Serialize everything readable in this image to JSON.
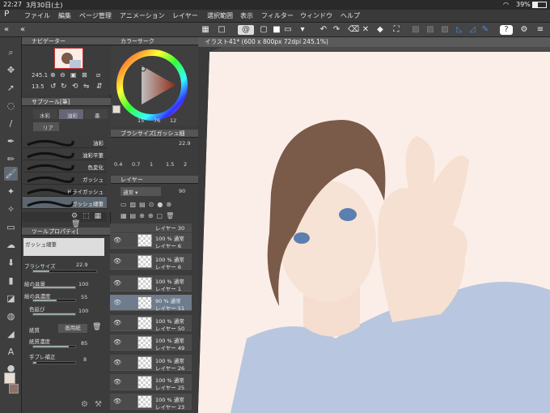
{
  "status": {
    "time": "22:27",
    "date": "3月30日(土)",
    "battery": "39%"
  },
  "menu": [
    "ファイル",
    "編集",
    "ページ管理",
    "アニメーション",
    "レイヤー",
    "選択範囲",
    "表示",
    "フィルター",
    "ウィンドウ",
    "ヘルプ"
  ],
  "document": {
    "tab": "イラスト41* (600 x 800px 72dpi 245.1%)"
  },
  "navigator": {
    "title": "ナビゲーター",
    "zoom": "245.1",
    "angle": "13.5"
  },
  "color": {
    "title": "カラーサーク",
    "h": "15",
    "s": "76",
    "v": "12"
  },
  "subtool": {
    "title": "サブツール[筆]",
    "tabs": [
      "水彩",
      "油彩",
      "墨"
    ],
    "group": "リア",
    "brushes": [
      "油彩",
      "油彩平筆",
      "色変化",
      "ガッシュ",
      "ドライガッシュ",
      "ガッシュ細筆"
    ]
  },
  "brushsize": {
    "title": "ブラシサイズ[ガッシュ細",
    "value": "22.9",
    "ticks": [
      "0.4",
      "0.7",
      "1",
      "1.5",
      "2"
    ]
  },
  "layer": {
    "title": "レイヤー",
    "blend": "通常",
    "opacity": "90",
    "rows": [
      {
        "l1": "100 % 通常",
        "l2": "レイヤー 6"
      },
      {
        "l1": "100 % 通常",
        "l2": "レイヤー 1"
      },
      {
        "l1": "90 % 通常",
        "l2": "レイヤー 51"
      },
      {
        "l1": "100 % 通常",
        "l2": "レイヤー 50"
      },
      {
        "l1": "100 % 通常",
        "l2": "レイヤー 49"
      },
      {
        "l1": "100 % 通常",
        "l2": "レイヤー 26"
      },
      {
        "l1": "100 % 通常",
        "l2": "レイヤー 25"
      },
      {
        "l1": "100 % 通常",
        "l2": "レイヤー 23"
      }
    ],
    "toprow": "レイヤー 30"
  },
  "toolprop": {
    "title": "ツールプロパティ[",
    "brushname": "ガッシュ細筆",
    "size_label": "ブラシサイズ",
    "size": "22.9",
    "paint_amount_label": "絵の具量",
    "paint_amount": "100",
    "paint_density_label": "絵の具濃度",
    "paint_density": "55",
    "blend_label": "色延び",
    "blend": "100",
    "paper_label": "紙質",
    "paper_value": "画用紙",
    "paper_density_label": "紙質濃度",
    "paper_density": "85",
    "stabilize_label": "手ブレ補正",
    "stabilize": "8"
  }
}
